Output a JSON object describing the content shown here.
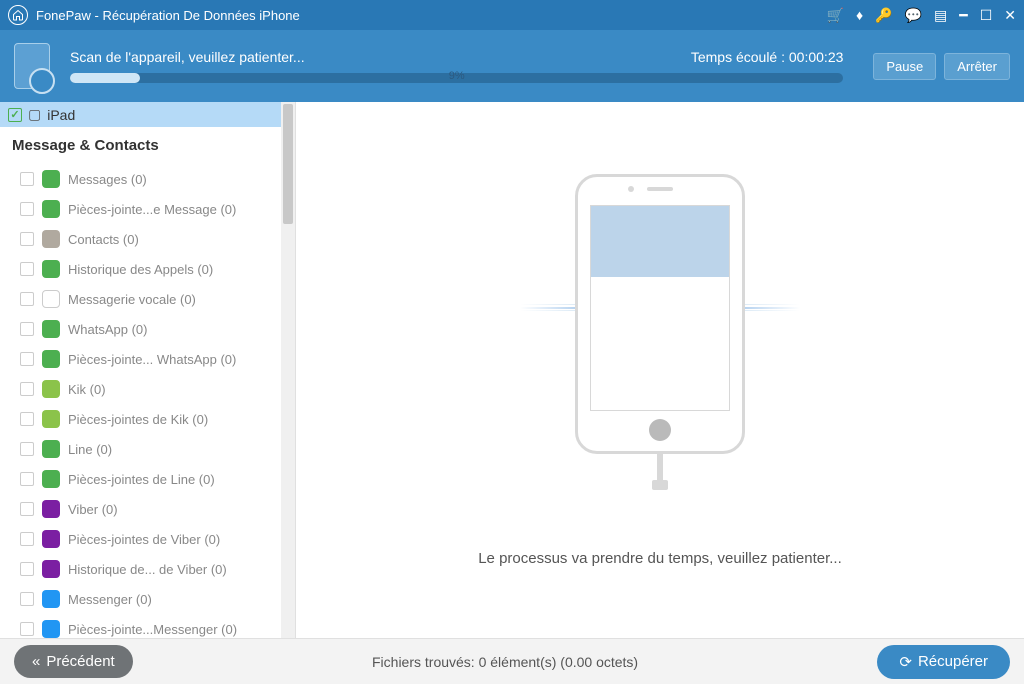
{
  "titlebar": {
    "title": "FonePaw - Récupération De Données iPhone"
  },
  "scan": {
    "message": "Scan de l'appareil, veuillez patienter...",
    "elapsed_label": "Temps écoulé : 00:00:23",
    "progress_pct": "9%",
    "pause": "Pause",
    "stop": "Arrêter"
  },
  "sidebar": {
    "device": "iPad",
    "section": "Message & Contacts",
    "items": [
      {
        "label": "Messages (0)",
        "color": "#4CAF50"
      },
      {
        "label": "Pièces-jointe...e Message (0)",
        "color": "#4CAF50"
      },
      {
        "label": "Contacts (0)",
        "color": "#b0a99f"
      },
      {
        "label": "Historique des Appels (0)",
        "color": "#4CAF50"
      },
      {
        "label": "Messagerie vocale (0)",
        "color": "#ffffff"
      },
      {
        "label": "WhatsApp (0)",
        "color": "#4CAF50"
      },
      {
        "label": "Pièces-jointe... WhatsApp (0)",
        "color": "#4CAF50"
      },
      {
        "label": "Kik (0)",
        "color": "#8BC34A"
      },
      {
        "label": "Pièces-jointes de Kik (0)",
        "color": "#8BC34A"
      },
      {
        "label": "Line (0)",
        "color": "#4CAF50"
      },
      {
        "label": "Pièces-jointes de Line (0)",
        "color": "#4CAF50"
      },
      {
        "label": "Viber (0)",
        "color": "#7B1FA2"
      },
      {
        "label": "Pièces-jointes de Viber (0)",
        "color": "#7B1FA2"
      },
      {
        "label": "Historique de... de Viber (0)",
        "color": "#7B1FA2"
      },
      {
        "label": "Messenger (0)",
        "color": "#2196F3"
      },
      {
        "label": "Pièces-jointe...Messenger (0)",
        "color": "#2196F3"
      }
    ]
  },
  "content": {
    "message": "Le processus va prendre du temps, veuillez patienter..."
  },
  "footer": {
    "prev": "Précédent",
    "status": "Fichiers trouvés: 0 élément(s) (0.00  octets)",
    "recover": "Récupérer"
  }
}
